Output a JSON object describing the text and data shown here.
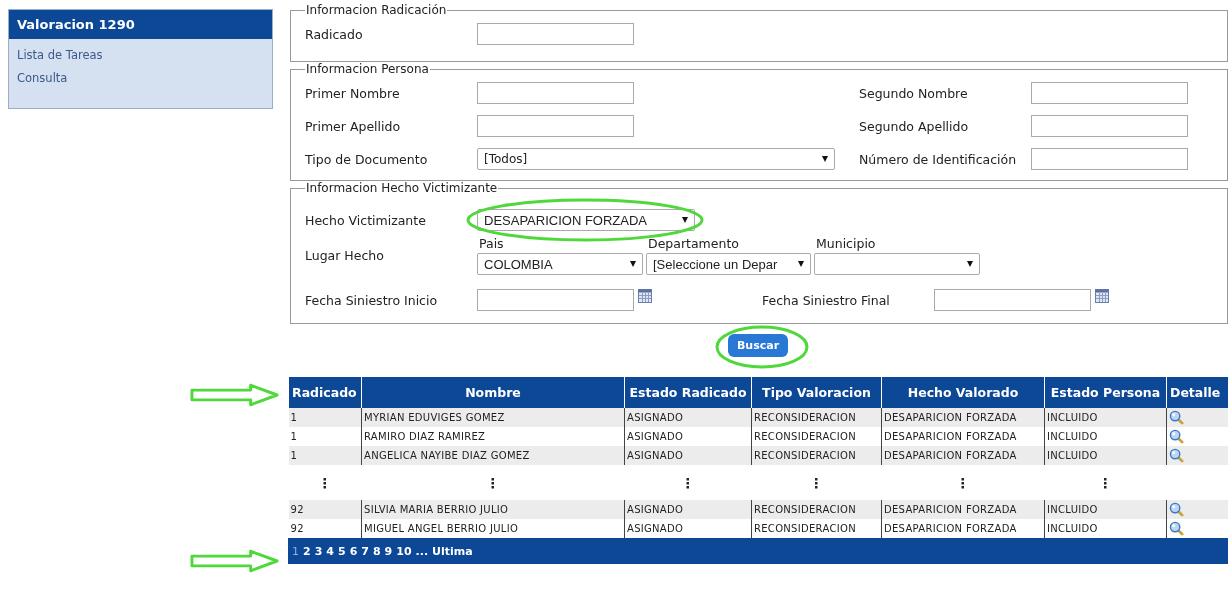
{
  "sidebar": {
    "title": "Valoracion 1290",
    "items": [
      {
        "label": "Lista de Tareas"
      },
      {
        "label": "Consulta"
      }
    ]
  },
  "radicacion": {
    "legend": "Informacion Radicación",
    "fields": [
      {
        "label": "Radicado",
        "kind": "text"
      }
    ]
  },
  "persona": {
    "legend": "Informacion Persona",
    "fields": [
      {
        "label": "Primer Nombre",
        "kind": "text"
      },
      {
        "label": "Segundo Nombre",
        "kind": "text"
      },
      {
        "label": "Primer Apellido",
        "kind": "text"
      },
      {
        "label": "Segundo Apellido",
        "kind": "text"
      },
      {
        "label": "Tipo de Documento",
        "kind": "select",
        "value": "[Todos]"
      },
      {
        "label": "Número de Identificación",
        "kind": "text"
      }
    ]
  },
  "hecho": {
    "legend": "Informacion Hecho Victimizante",
    "hecho_label": "Hecho Victimizante",
    "hecho_value": "DESAPARICION FORZADA",
    "lugar_label": "Lugar Hecho",
    "lugar": [
      {
        "heading": "Pais",
        "value": "COLOMBIA"
      },
      {
        "heading": "Departamento",
        "value": "[Seleccione un Depar"
      },
      {
        "heading": "Municipio"
      }
    ],
    "fecha_inicio_label": "Fecha Siniestro Inicio",
    "fecha_final_label": "Fecha Siniestro Final"
  },
  "search_button": "Buscar",
  "table": {
    "columns": [
      "Radicado",
      "Nombre",
      "Estado Radicado",
      "Tipo Valoracion",
      "Hecho Valorado",
      "Estado Persona",
      "Detalle"
    ],
    "rows": [
      {
        "kind": "data",
        "cells": [
          "1",
          "MYRIAN EDUVIGES GOMEZ",
          "ASIGNADO",
          "RECONSIDERACION",
          "DESAPARICION FORZADA",
          "INCLUIDO"
        ]
      },
      {
        "kind": "data",
        "cells": [
          "1",
          "RAMIRO DIAZ RAMIREZ",
          "ASIGNADO",
          "RECONSIDERACION",
          "DESAPARICION FORZADA",
          "INCLUIDO"
        ]
      },
      {
        "kind": "data",
        "cells": [
          "1",
          "ANGELICA NAYIBE DIAZ GOMEZ",
          "ASIGNADO",
          "RECONSIDERACION",
          "DESAPARICION FORZADA",
          "INCLUIDO"
        ]
      },
      {
        "kind": "gap",
        "cells": [
          "⋮",
          "⋮",
          "⋮",
          "⋮",
          "⋮",
          "⋮"
        ]
      },
      {
        "kind": "data",
        "cells": [
          "92",
          "SILVIA MARIA BERRIO JULIO",
          "ASIGNADO",
          "RECONSIDERACION",
          "DESAPARICION FORZADA",
          "INCLUIDO"
        ]
      },
      {
        "kind": "data",
        "cells": [
          "92",
          "MIGUEL ANGEL BERRIO JULIO",
          "ASIGNADO",
          "RECONSIDERACION",
          "DESAPARICION FORZADA",
          "INCLUIDO"
        ]
      }
    ],
    "pages": [
      {
        "label": "1",
        "selected": true
      },
      {
        "label": "2",
        "selected": false
      },
      {
        "label": "3",
        "selected": false
      },
      {
        "label": "4",
        "selected": false
      },
      {
        "label": "5",
        "selected": false
      },
      {
        "label": "6",
        "selected": false
      },
      {
        "label": "7",
        "selected": false
      },
      {
        "label": "8",
        "selected": false
      },
      {
        "label": "9",
        "selected": false
      },
      {
        "label": "10",
        "selected": false
      },
      {
        "label": "...",
        "selected": false
      },
      {
        "label": "Ultima",
        "selected": false
      }
    ]
  }
}
